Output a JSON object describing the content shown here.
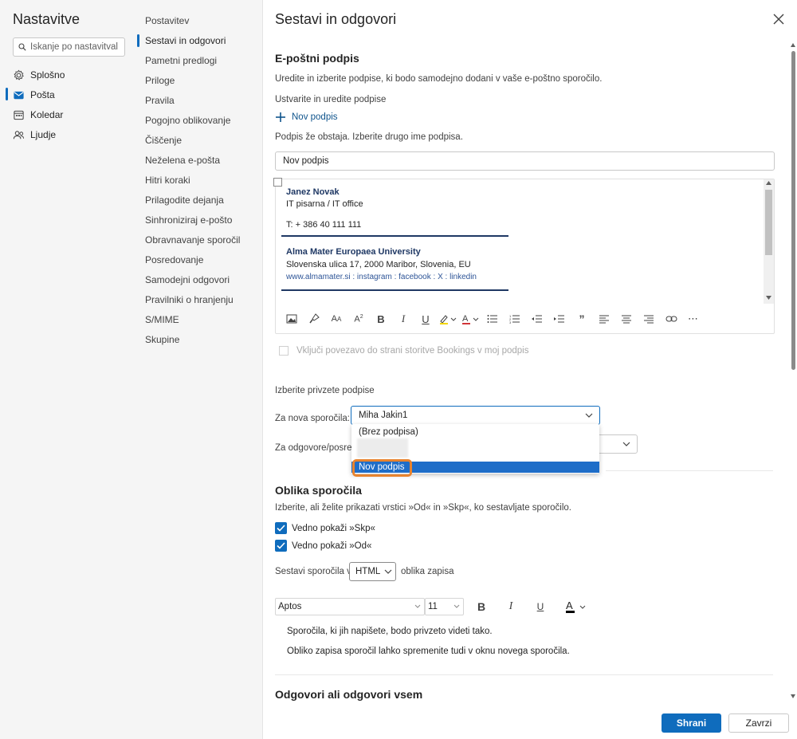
{
  "left_nav": {
    "title": "Nastavitve",
    "search_placeholder": "Iskanje po nastavitval",
    "categories": [
      {
        "label": "Splošno",
        "icon": "gear-icon"
      },
      {
        "label": "Pošta",
        "icon": "mail-icon",
        "active": true
      },
      {
        "label": "Koledar",
        "icon": "calendar-icon"
      },
      {
        "label": "Ljudje",
        "icon": "people-icon"
      }
    ]
  },
  "mid_nav": {
    "items": [
      "Postavitev",
      "Sestavi in odgovori",
      "Pametni predlogi",
      "Priloge",
      "Pravila",
      "Pogojno oblikovanje",
      "Čiščenje",
      "Neželena e-pošta",
      "Hitri koraki",
      "Prilagodite dejanja",
      "Sinhroniziraj e-pošto",
      "Obravnavanje sporočil",
      "Posredovanje",
      "Samodejni odgovori",
      "Pravilniki o hranjenju",
      "S/MIME",
      "Skupine"
    ],
    "active": "Sestavi in odgovori"
  },
  "main": {
    "title": "Sestavi in odgovori",
    "signature_section": {
      "heading": "E-poštni podpis",
      "description": "Uredite in izberite podpise, ki bodo samodejno dodani v vaše e-poštno sporočilo.",
      "create_label": "Ustvarite in uredite podpise",
      "new_signature": "Nov podpis",
      "warning": "Podpis že obstaja. Izberite drugo ime podpisa.",
      "name_value": "Nov podpis",
      "content": {
        "name": "Janez Novak",
        "role": "IT pisarna / IT office",
        "phone": "T: + 386 40 111 111",
        "org": "Alma Mater Europaea University",
        "address": "Slovenska ulica 17, 2000 Maribor, Slovenia, EU",
        "links": "www.almamater.si : instagram : facebook : X : linkedin"
      },
      "bookings": "Vključi povezavo do strani storitve Bookings v moj podpis"
    },
    "defaults": {
      "label": "Izberite privzete podpise",
      "new_messages_label": "Za nova sporočila:",
      "new_messages_value": "Miha Jakin1",
      "replies_label": "Za odgovore/posredovanja:",
      "dropdown_options": [
        "(Brez podpisa)",
        "Nov podpis"
      ],
      "dropdown_selected": "Nov podpis"
    },
    "format_section": {
      "heading": "Oblika sporočila",
      "description": "Izberite, ali želite prikazati vrstici »Od« in »Skp«, ko sestavljate sporočilo.",
      "always_bcc": "Vedno pokaži »Skp«",
      "always_from": "Vedno pokaži »Od«",
      "compose_in": "Sestavi sporočila v",
      "compose_format": "HTML",
      "format_suffix": "oblika zapisa",
      "font": "Aptos",
      "size": "11",
      "preview_line1": "Sporočila, ki jih napišete, bodo privzeto videti tako.",
      "preview_line2": "Obliko zapisa sporočil lahko spremenite tudi v oknu novega sporočila."
    },
    "reply_section": {
      "heading": "Odgovori ali odgovori vsem"
    }
  },
  "footer": {
    "save": "Shrani",
    "discard": "Zavrzi"
  },
  "colors": {
    "accent": "#0f6cbd",
    "highlight": "#e8832e",
    "signature_text": "#1f3864"
  }
}
